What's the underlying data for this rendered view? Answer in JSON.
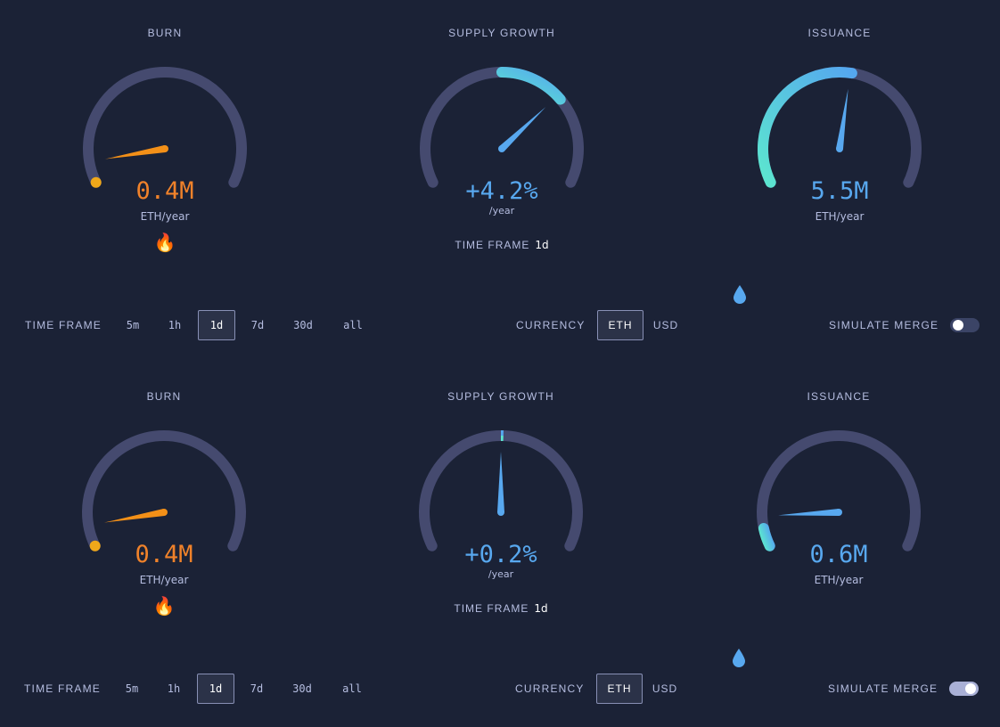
{
  "colors": {
    "background": "#1b2236",
    "track": "#454a6f",
    "burn": "#f39018",
    "burn_value": "#f0822a",
    "issuance": "#58a8ef",
    "fill_start": "#5ce6cf",
    "fill_end": "#55a7ef"
  },
  "panels": [
    {
      "burn": {
        "title": "BURN",
        "value": "0.4M",
        "unit": "ETH/year",
        "icon": "fire-icon",
        "fraction": 0.0
      },
      "supply_growth": {
        "title": "SUPPLY GROWTH",
        "value": "+4.2%",
        "unit": "/year",
        "time_frame_label": "TIME FRAME",
        "time_frame_value": "1d",
        "fill_from": 0.5,
        "fill_to": 0.715,
        "needle": 0.7
      },
      "issuance": {
        "title": "ISSUANCE",
        "value": "5.5M",
        "unit": "ETH/year",
        "icon": "droplet-icon",
        "fraction": 0.54
      },
      "controls": {
        "time_frame_label": "TIME FRAME",
        "time_frame_options": [
          "5m",
          "1h",
          "1d",
          "7d",
          "30d",
          "all"
        ],
        "time_frame_selected": "1d",
        "currency_label": "CURRENCY",
        "currency_options": [
          "ETH",
          "USD"
        ],
        "currency_selected": "ETH",
        "simulate_merge_label": "SIMULATE MERGE",
        "simulate_merge_on": false
      }
    },
    {
      "burn": {
        "title": "BURN",
        "value": "0.4M",
        "unit": "ETH/year",
        "icon": "fire-icon",
        "fraction": 0.0
      },
      "supply_growth": {
        "title": "SUPPLY GROWTH",
        "value": "+0.2%",
        "unit": "/year",
        "time_frame_label": "TIME FRAME",
        "time_frame_value": "1d",
        "fill_from": 0.5,
        "fill_to": 0.508,
        "needle": 0.5
      },
      "issuance": {
        "title": "ISSUANCE",
        "value": "0.6M",
        "unit": "ETH/year",
        "icon": "droplet-icon",
        "fraction": 0.06
      },
      "controls": {
        "time_frame_label": "TIME FRAME",
        "time_frame_options": [
          "5m",
          "1h",
          "1d",
          "7d",
          "30d",
          "all"
        ],
        "time_frame_selected": "1d",
        "currency_label": "CURRENCY",
        "currency_options": [
          "ETH",
          "USD"
        ],
        "currency_selected": "ETH",
        "simulate_merge_label": "SIMULATE MERGE",
        "simulate_merge_on": true
      }
    }
  ]
}
